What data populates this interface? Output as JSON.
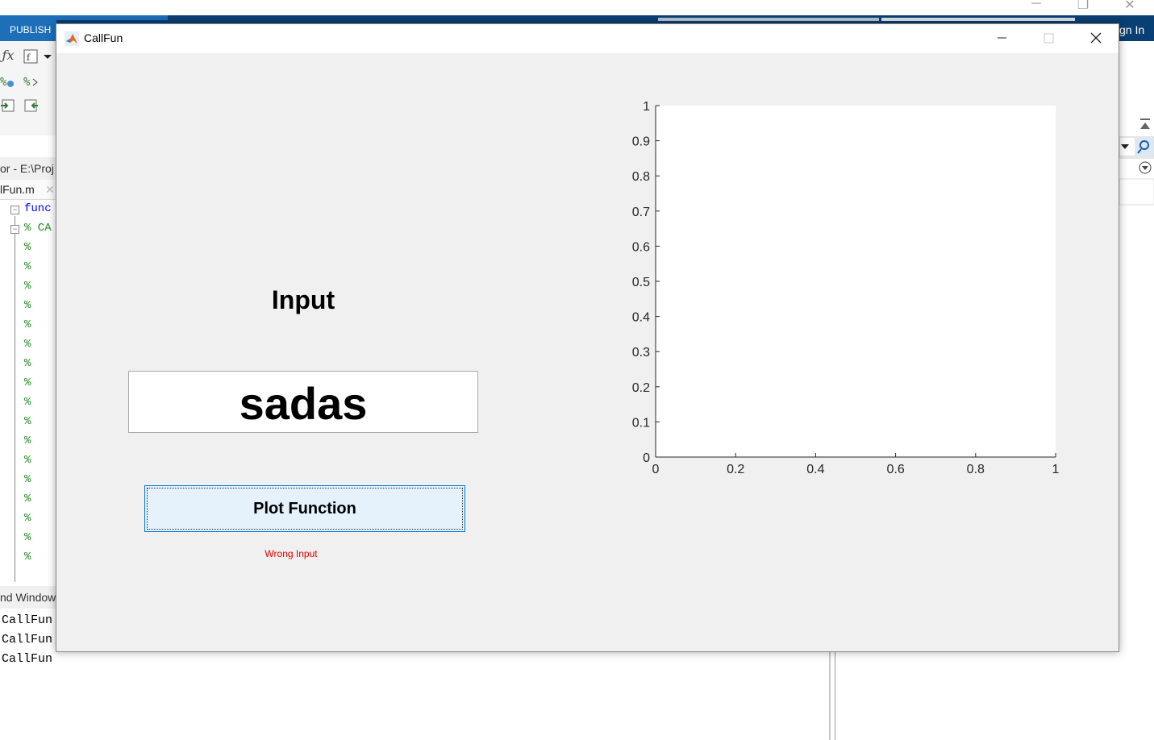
{
  "background": {
    "ribbon": {
      "publish_tab": "PUBLISH",
      "sign_in": "gn In"
    },
    "toolstrip_icons": [
      "fx-icon",
      "insert-function-icon",
      "dropdown-icon",
      "comment-icon",
      "uncomment-icon",
      "indent-icon",
      "outdent-icon"
    ],
    "editor": {
      "title": "or - E:\\Proj",
      "tab_label": "lFun.m",
      "tab_close": "✕",
      "code_lines": [
        "func",
        "% CA",
        "%",
        "%",
        "%",
        "%",
        "%",
        "%",
        "%",
        "%",
        "%",
        "%",
        "%",
        "%",
        "%",
        "%",
        "%",
        "%",
        "%"
      ]
    },
    "command_window": {
      "title": "nd Window",
      "lines": [
        "CallFun",
        "CallFun",
        "CallFun"
      ]
    },
    "window_controls": {
      "minimize": "─",
      "restore": "❐",
      "close": "✕"
    }
  },
  "figure": {
    "title": "CallFun",
    "input_label": "Input",
    "input_value": "sadas",
    "plot_button_label": "Plot Function",
    "error_text": "Wrong Input"
  },
  "colors": {
    "ribbon_dark": "#0a3f73",
    "ribbon_tab": "#1d6fb8",
    "error": "#e00000",
    "button_focus": "#0078d7",
    "code_keyword": "#0000ff",
    "code_comment": "#228b22"
  },
  "chart_data": {
    "type": "line",
    "title": "",
    "xlabel": "",
    "ylabel": "",
    "xlim": [
      0,
      1
    ],
    "ylim": [
      0,
      1
    ],
    "xticks": [
      0,
      0.2,
      0.4,
      0.6,
      0.8,
      1
    ],
    "yticks": [
      0,
      0.1,
      0.2,
      0.3,
      0.4,
      0.5,
      0.6,
      0.7,
      0.8,
      0.9,
      1
    ],
    "xtick_labels": [
      "0",
      "0.2",
      "0.4",
      "0.6",
      "0.8",
      "1"
    ],
    "ytick_labels": [
      "0",
      "0.1",
      "0.2",
      "0.3",
      "0.4",
      "0.5",
      "0.6",
      "0.7",
      "0.8",
      "0.9",
      "1"
    ],
    "series": [],
    "grid": false
  }
}
